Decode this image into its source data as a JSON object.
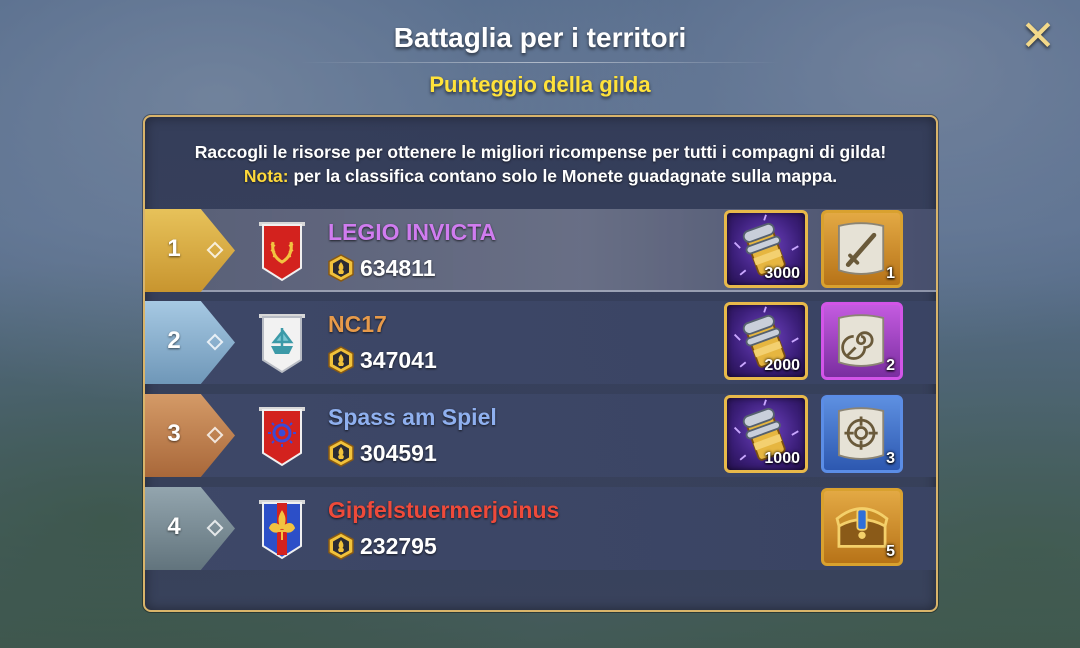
{
  "header": {
    "title": "Battaglia per i territori",
    "subtitle": "Punteggio della gilda",
    "close_icon": "close-icon"
  },
  "description": {
    "line1": "Raccogli le risorse per ottenere le migliori ricompense per tutti i compagni di gilda!",
    "note_label": "Nota:",
    "note_text": " per la classifica contano solo le Monete guadagnate sulla mappa."
  },
  "rows": [
    {
      "rank": "1",
      "rank_color": "gold",
      "guild_name": "LEGIO INVICTA",
      "name_color": "#d07cf0",
      "score": "634811",
      "banner_icon": "laurel-wreath-banner-icon",
      "rewards": [
        {
          "icon": "scroll-bundle-icon",
          "count": "3000"
        },
        {
          "icon": "sword-map-icon",
          "count": "1"
        }
      ]
    },
    {
      "rank": "2",
      "rank_color": "silver",
      "guild_name": "NC17",
      "name_color": "#e79a4a",
      "score": "347041",
      "banner_icon": "ship-banner-icon",
      "rewards": [
        {
          "icon": "scroll-bundle-icon",
          "count": "2000"
        },
        {
          "icon": "spiral-map-icon",
          "count": "2"
        }
      ]
    },
    {
      "rank": "3",
      "rank_color": "bronze",
      "guild_name": "Spass am Spiel",
      "name_color": "#8fb0ef",
      "score": "304591",
      "banner_icon": "eye-banner-icon",
      "rewards": [
        {
          "icon": "scroll-bundle-icon",
          "count": "1000"
        },
        {
          "icon": "target-map-icon",
          "count": "3"
        }
      ]
    },
    {
      "rank": "4",
      "rank_color": "grey",
      "guild_name": "Gipfelstuermerjoinus",
      "name_color": "#ee4a3a",
      "score": "232795",
      "banner_icon": "fleur-de-lis-banner-icon",
      "rewards": [
        {
          "icon": "treasure-chest-icon",
          "count": "5"
        }
      ]
    }
  ],
  "colors": {
    "accent_yellow": "#ffe23a",
    "panel_border": "#d9b46a"
  }
}
